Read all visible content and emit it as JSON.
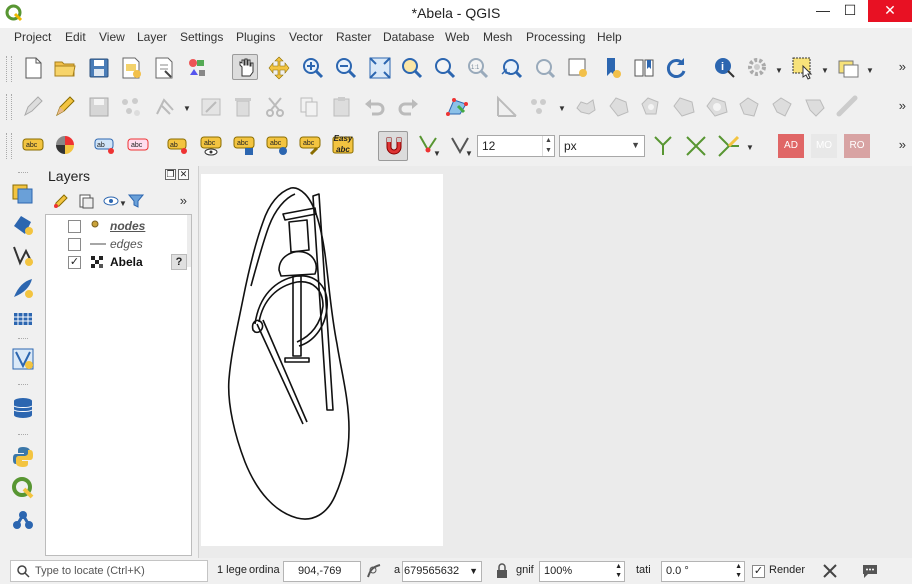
{
  "window": {
    "title": "*Abela - QGIS",
    "minimize": "—",
    "maximize": "☐",
    "close": "✕"
  },
  "menu": {
    "items": [
      "Project",
      "Edit",
      "View",
      "Layer",
      "Settings",
      "Plugins",
      "Vector",
      "Raster",
      "Database",
      "Web",
      "Mesh",
      "Processing",
      "Help"
    ]
  },
  "toolbar_digitizing": {
    "overflow": "»"
  },
  "toolbar_labels": {
    "snap_tolerance": "12",
    "snap_units": "px",
    "btn_ad": "AD",
    "btn_mo": "MO",
    "btn_ro": "RO",
    "btn_easy_top": "Easy",
    "btn_easy_bottom": "abc",
    "overflow": "»"
  },
  "layers_panel": {
    "title": "Layers",
    "overflow": "»",
    "layers": [
      {
        "name": "nodes",
        "checked": false,
        "icon": "point-layer-icon"
      },
      {
        "name": "edges",
        "checked": false,
        "icon": "line-layer-icon"
      },
      {
        "name": "Abela",
        "checked": true,
        "icon": "raster-layer-icon",
        "badge": "?"
      }
    ]
  },
  "statusbar": {
    "locator_placeholder": "Type to locate (Ctrl+K)",
    "legend_text": "1 lege",
    "coordinate_label": "ordina",
    "coordinate_value": "904,-769",
    "scale_label": "a",
    "scale_value": "679565632",
    "magnifier_label": "gnif",
    "magnifier_value": "100%",
    "rotation_label": "tati",
    "rotation_value": "0.0 °",
    "render_label": "Render",
    "render_checked": true
  },
  "colors": {
    "accent_green": "#589632",
    "close_red": "#e81123",
    "label_red": "#e06666"
  }
}
